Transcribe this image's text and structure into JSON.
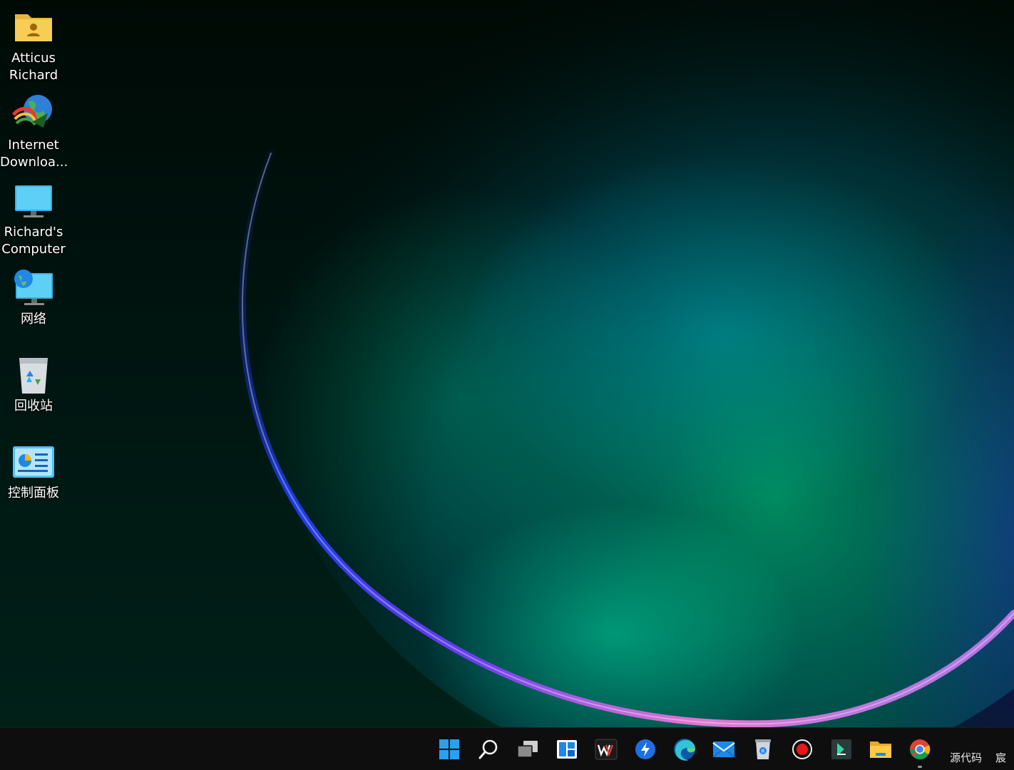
{
  "desktop": {
    "icons": [
      {
        "label": "Atticus\nRichard",
        "icon": "user-folder-icon"
      },
      {
        "label": "Internet\nDownloa...",
        "icon": "internet-download-manager-icon"
      },
      {
        "label": "Richard's\nComputer",
        "icon": "computer-icon"
      },
      {
        "label": "网络",
        "icon": "network-icon"
      },
      {
        "label": "回收站",
        "icon": "recycle-bin-icon"
      },
      {
        "label": "控制面板",
        "icon": "control-panel-icon"
      }
    ]
  },
  "taskbar": {
    "apps": [
      {
        "name": "start-button",
        "icon": "windows-logo-icon"
      },
      {
        "name": "search-button",
        "icon": "search-icon"
      },
      {
        "name": "task-view-button",
        "icon": "task-view-icon"
      },
      {
        "name": "widgets-button",
        "icon": "widgets-icon"
      },
      {
        "name": "wps-office-button",
        "icon": "wps-icon"
      },
      {
        "name": "thunder-button",
        "icon": "thunder-icon"
      },
      {
        "name": "edge-browser-button",
        "icon": "edge-icon"
      },
      {
        "name": "mail-button",
        "icon": "mail-icon"
      },
      {
        "name": "recycle-tool-button",
        "icon": "recycle-tool-icon"
      },
      {
        "name": "screen-recorder-button",
        "icon": "record-icon"
      },
      {
        "name": "code-editor-button",
        "icon": "code-editor-icon"
      },
      {
        "name": "file-explorer-button",
        "icon": "folder-icon"
      },
      {
        "name": "chrome-button",
        "icon": "chrome-icon",
        "active": true
      }
    ],
    "tray": {
      "text1": "源代码",
      "text2": "宸"
    }
  },
  "colors": {
    "taskbar_bg": "#0e0e0e",
    "accent_blue": "#0078d4"
  }
}
